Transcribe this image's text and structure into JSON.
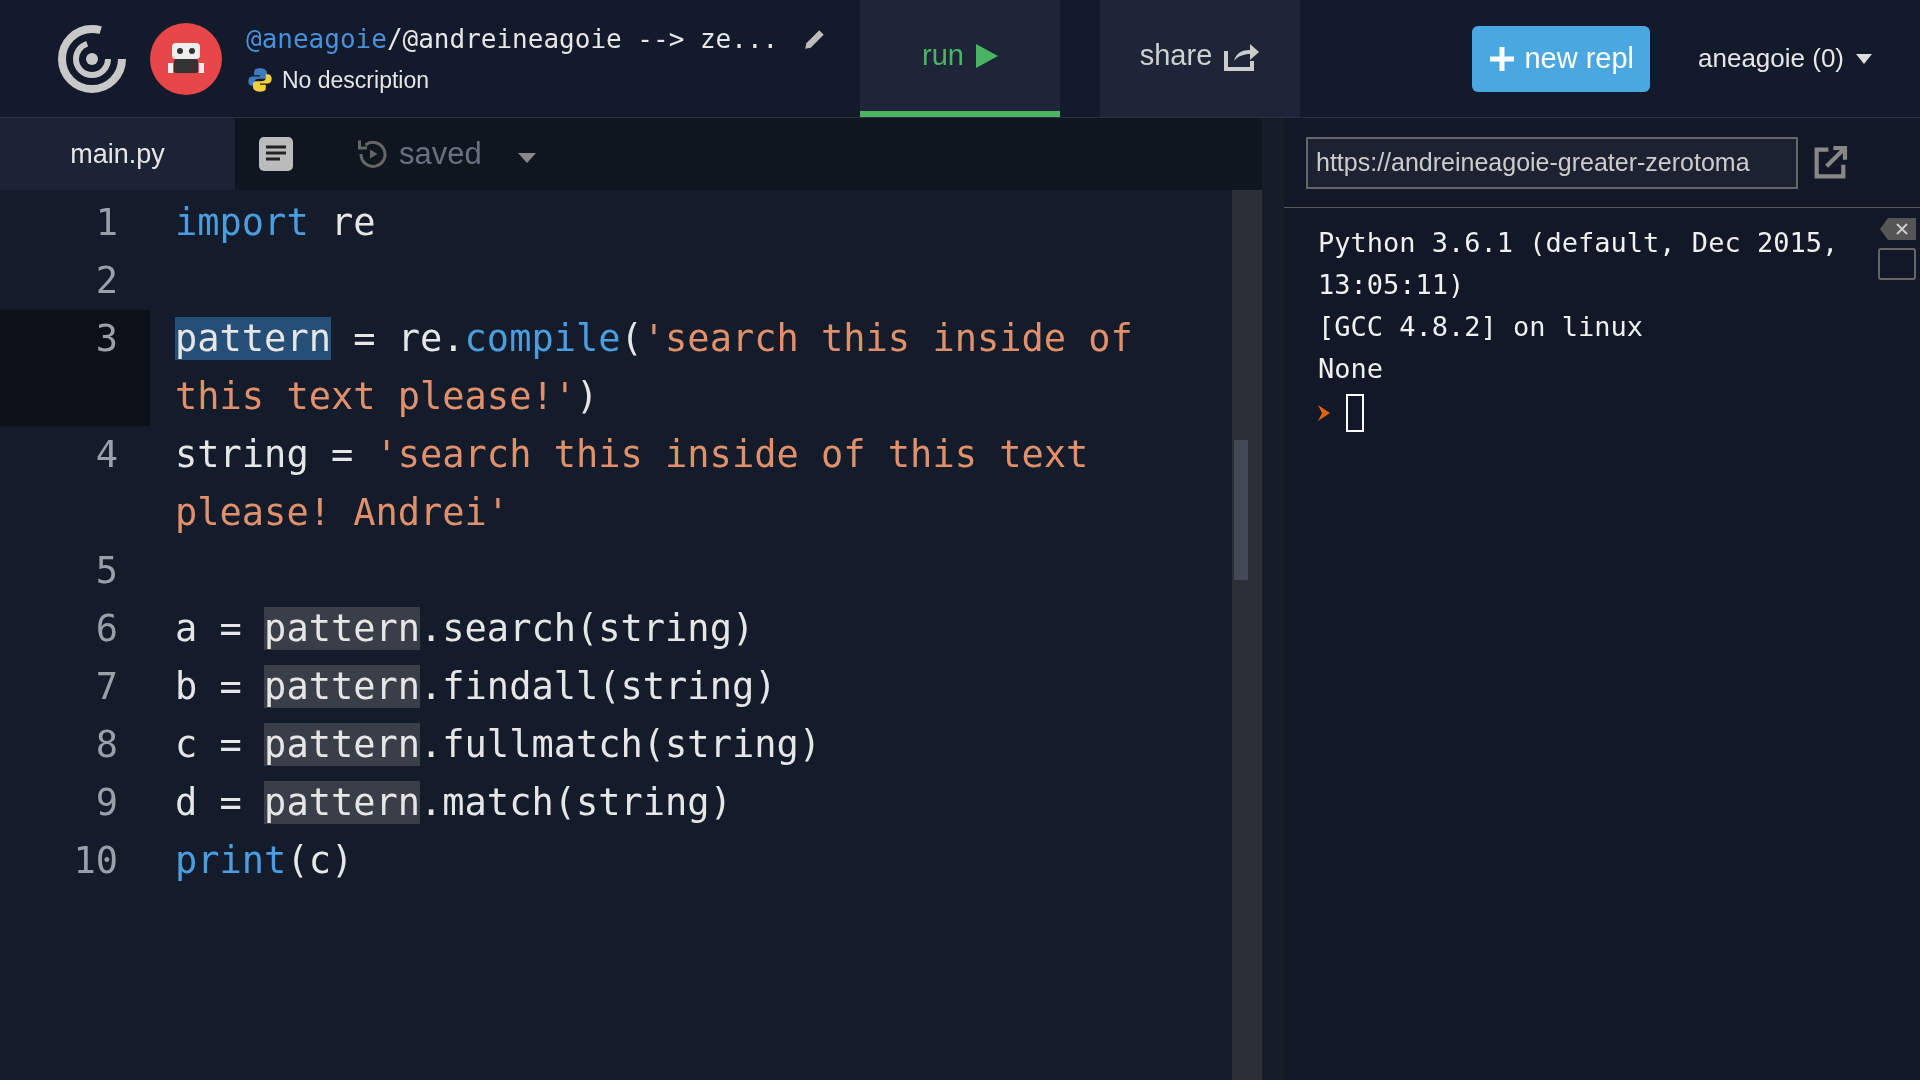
{
  "header": {
    "owner": "@aneagoie",
    "title": "/@andreineagoie --> ze...",
    "description": "No description",
    "tabs": [
      {
        "label": "run",
        "selected": true
      },
      {
        "label": "share",
        "selected": false
      }
    ],
    "new_button": "new repl",
    "user": "aneagoie (0)"
  },
  "editor": {
    "file_tab": "main.py",
    "status": "saved",
    "lines": [
      {
        "number": "1",
        "active": false,
        "tokens": [
          {
            "kind": "keyword",
            "text": "import"
          },
          {
            "kind": "plain",
            "text": " re"
          }
        ]
      },
      {
        "number": "2",
        "active": false
      },
      {
        "number": "3",
        "active": true,
        "tokens": [
          {
            "kind": "selected",
            "text": "pattern"
          },
          {
            "kind": "plain",
            "text": " = re."
          },
          {
            "kind": "keyword",
            "text": "compile"
          },
          {
            "kind": "plain",
            "text": "("
          },
          {
            "kind": "string",
            "text": "'search this inside of this text please!'"
          },
          {
            "kind": "plain",
            "text": ")"
          }
        ]
      },
      {
        "number": "4",
        "active": false,
        "tokens": [
          {
            "kind": "plain",
            "text": "string = "
          },
          {
            "kind": "string",
            "text": "'search this inside of this text please! Andrei'"
          }
        ]
      },
      {
        "number": "5",
        "active": false
      },
      {
        "number": "6",
        "active": false,
        "tokens": [
          {
            "kind": "plain",
            "text": "a = "
          },
          {
            "kind": "occurrence",
            "text": "pattern"
          },
          {
            "kind": "plain",
            "text": ".search(string)"
          }
        ]
      },
      {
        "number": "7",
        "active": false,
        "tokens": [
          {
            "kind": "plain",
            "text": "b = "
          },
          {
            "kind": "occurrence",
            "text": "pattern"
          },
          {
            "kind": "plain",
            "text": ".findall(string)"
          }
        ]
      },
      {
        "number": "8",
        "active": false,
        "tokens": [
          {
            "kind": "plain",
            "text": "c = "
          },
          {
            "kind": "occurrence",
            "text": "pattern"
          },
          {
            "kind": "plain",
            "text": ".fullmatch(string)"
          }
        ]
      },
      {
        "number": "9",
        "active": false,
        "tokens": [
          {
            "kind": "plain",
            "text": "d = "
          },
          {
            "kind": "occurrence",
            "text": "pattern"
          },
          {
            "kind": "plain",
            "text": ".match(string)"
          }
        ]
      },
      {
        "number": "10",
        "active": false,
        "tokens": [
          {
            "kind": "keyword",
            "text": "print"
          },
          {
            "kind": "plain",
            "text": "(c)"
          }
        ]
      }
    ]
  },
  "console": {
    "url": "https://andreineagoie-greater-zerotoma",
    "output": [
      "Python 3.6.1 (default, Dec 2015, 13:05:11)",
      "[GCC 4.8.2] on linux",
      "None"
    ]
  }
}
